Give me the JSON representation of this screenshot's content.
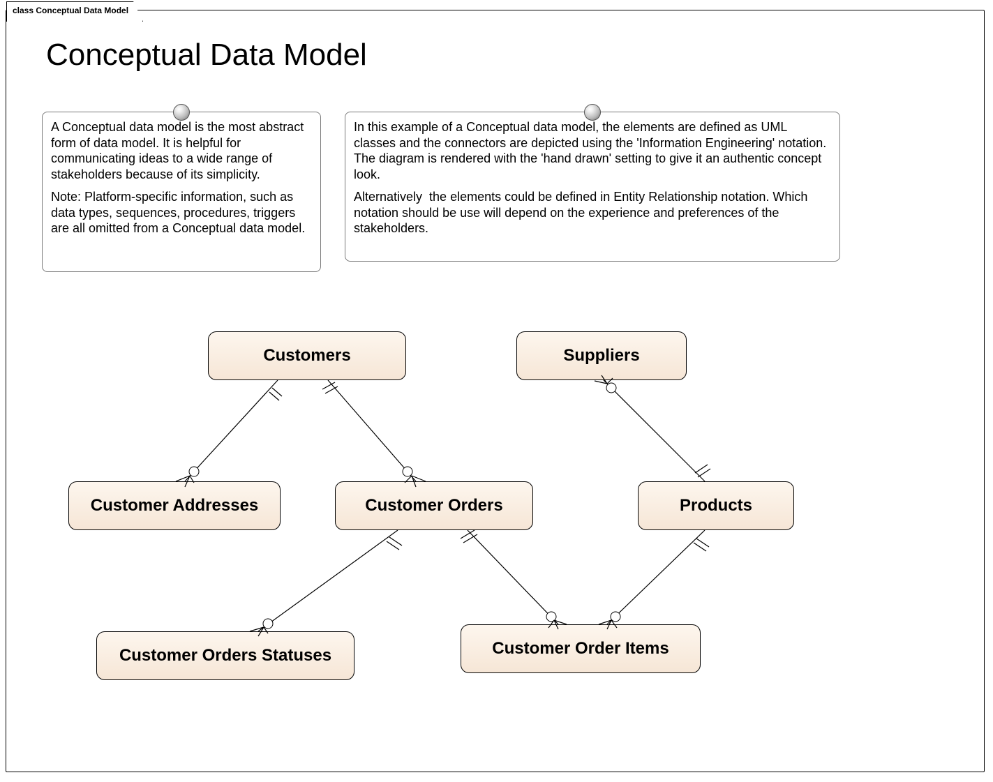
{
  "tab_label": "class Conceptual Data Model",
  "title": "Conceptual Data Model",
  "notes": {
    "left": {
      "p1": "A Conceptual data model is the most abstract form of data model. It is helpful for communicating ideas to a wide range of stakeholders because of its simplicity.",
      "p2": "Note: Platform-specific information, such as data types, sequences, procedures, triggers are all omitted from a Conceptual data model."
    },
    "right": {
      "p1": "In this example of a Conceptual data model, the elements are defined as UML classes and the connectors are depicted using the 'Information Engineering' notation.  The diagram is rendered with the 'hand drawn' setting to give it an authentic concept look.",
      "p2": "Alternatively  the elements could be defined in Entity Relationship notation. Which notation should be use will depend on the experience and preferences of the stakeholders."
    }
  },
  "entities": {
    "customers": "Customers",
    "suppliers": "Suppliers",
    "customer_addresses": "Customer Addresses",
    "customer_orders": "Customer Orders",
    "products": "Products",
    "customer_orders_statuses": "Customer Orders Statuses",
    "customer_order_items": "Customer Order Items"
  },
  "relationships": [
    {
      "from": "Customers",
      "to": "Customer Addresses",
      "from_card": "one-mandatory",
      "to_card": "many-optional"
    },
    {
      "from": "Customers",
      "to": "Customer Orders",
      "from_card": "one-mandatory",
      "to_card": "many-optional"
    },
    {
      "from": "Suppliers",
      "to": "Products",
      "from_card": "many-optional",
      "to_card": "one-mandatory"
    },
    {
      "from": "Customer Orders",
      "to": "Customer Orders Statuses",
      "from_card": "one-mandatory",
      "to_card": "many-optional"
    },
    {
      "from": "Customer Orders",
      "to": "Customer Order Items",
      "from_card": "one-mandatory",
      "to_card": "many-optional"
    },
    {
      "from": "Products",
      "to": "Customer Order Items",
      "from_card": "one-mandatory",
      "to_card": "many-optional"
    }
  ],
  "notation": "Information Engineering (crow's foot)",
  "style_note": "hand drawn"
}
